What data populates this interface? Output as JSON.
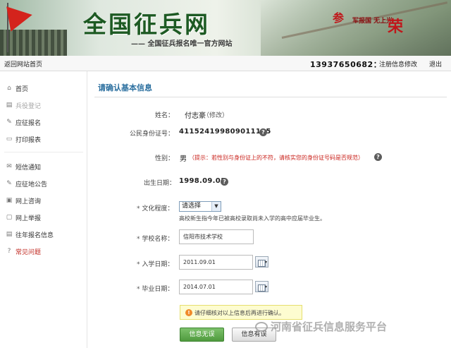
{
  "banner": {
    "title": "全国征兵网",
    "subtitle": "—— 全国征兵报名唯一官方网站",
    "slogan_1": "参",
    "slogan_2": "军报国 无上光",
    "slogan_3": "荣"
  },
  "topnav": {
    "home_link": "返回网站首页",
    "phone": "13937650682",
    "separator": "：",
    "edit_link": "注册信息修改",
    "logout": "退出"
  },
  "sidebar": {
    "items": [
      {
        "label": "首页",
        "icon": "house-icon"
      },
      {
        "label": "兵役登记",
        "icon": "note-icon",
        "state": "disabled"
      },
      {
        "label": "应征报名",
        "icon": "pen-icon"
      },
      {
        "label": "打印报表",
        "icon": "printer-icon"
      },
      {
        "label": "短信通知",
        "icon": "envelope-icon"
      },
      {
        "label": "应征地公告",
        "icon": "edit-icon"
      },
      {
        "label": "网上咨询",
        "icon": "chat-icon"
      },
      {
        "label": "网上举报",
        "icon": "report-icon"
      },
      {
        "label": "往年报名信息",
        "icon": "document-icon"
      },
      {
        "label": "常见问题",
        "icon": "question-icon",
        "state": "highlight"
      }
    ]
  },
  "form": {
    "heading": "请确认基本信息",
    "name_label": "姓名：",
    "name_value": "付志豪",
    "name_edit": "（修改）",
    "id_label": "公民身份证号：",
    "id_value": "411524199809011115",
    "gender_label": "性别：",
    "gender_value": "男",
    "gender_hint": "（提示：若性别与身份证上的不符，请核实您的身份证号码是否规范）",
    "birth_label": "出生日期：",
    "birth_value": "1998.09.01",
    "education_label": "文化程度：",
    "education_selected": "请选择",
    "education_note": "高校新生指今年已被高校录取尚未入学的高中应届毕业生。",
    "school_label": "学校名称：",
    "school_value": "信阳市技术学校",
    "enroll_label": "入学日期：",
    "enroll_value": "2011.09.01",
    "grad_label": "毕业日期：",
    "grad_value": "2014.07.01",
    "required_mark": "*",
    "help_mark": "?",
    "confirm_notice": "请仔细核对以上信息后再进行确认。",
    "ok_button": "信息无误",
    "wrong_button": "信息有误"
  },
  "watermark": "河南省征兵信息服务平台"
}
